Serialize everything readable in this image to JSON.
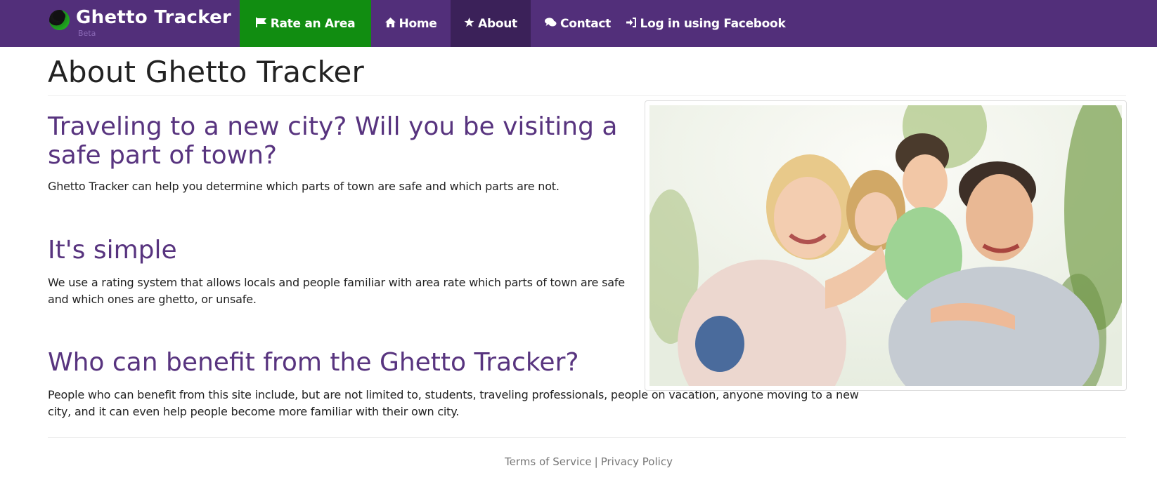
{
  "navbar": {
    "brand": {
      "title": "Ghetto Tracker",
      "badge": "Beta"
    },
    "items": [
      {
        "icon": "flag-icon",
        "label": "Rate an Area",
        "active_color": "#118d11"
      },
      {
        "icon": "home-icon",
        "label": "Home"
      },
      {
        "icon": "star-icon",
        "label": "About",
        "active": true
      },
      {
        "icon": "chat-icon",
        "label": "Contact"
      },
      {
        "icon": "login-icon",
        "label": "Log in using Facebook"
      }
    ],
    "background_color": "#522f7a"
  },
  "main": {
    "title": "About Ghetto Tracker",
    "sections": [
      {
        "heading": "Traveling to a new city? Will you be visiting a safe part of town?",
        "body": "Ghetto Tracker can help you determine which parts of town are safe and which parts are not."
      },
      {
        "heading": "It's simple",
        "body": "We use a rating system that allows locals and people familiar with area rate which parts of town are safe and which ones are ghetto, or unsafe."
      },
      {
        "heading": "Who can benefit from the Ghetto Tracker?",
        "body": "People who can benefit from this site include, but are not limited to, students, traveling professionals, people on vacation, anyone moving to a new city, and it can even help people become more familiar with their own city."
      }
    ],
    "heading_color": "#58347f"
  },
  "footer": {
    "terms": "Terms of Service",
    "separator": "|",
    "privacy": "Privacy Policy"
  }
}
